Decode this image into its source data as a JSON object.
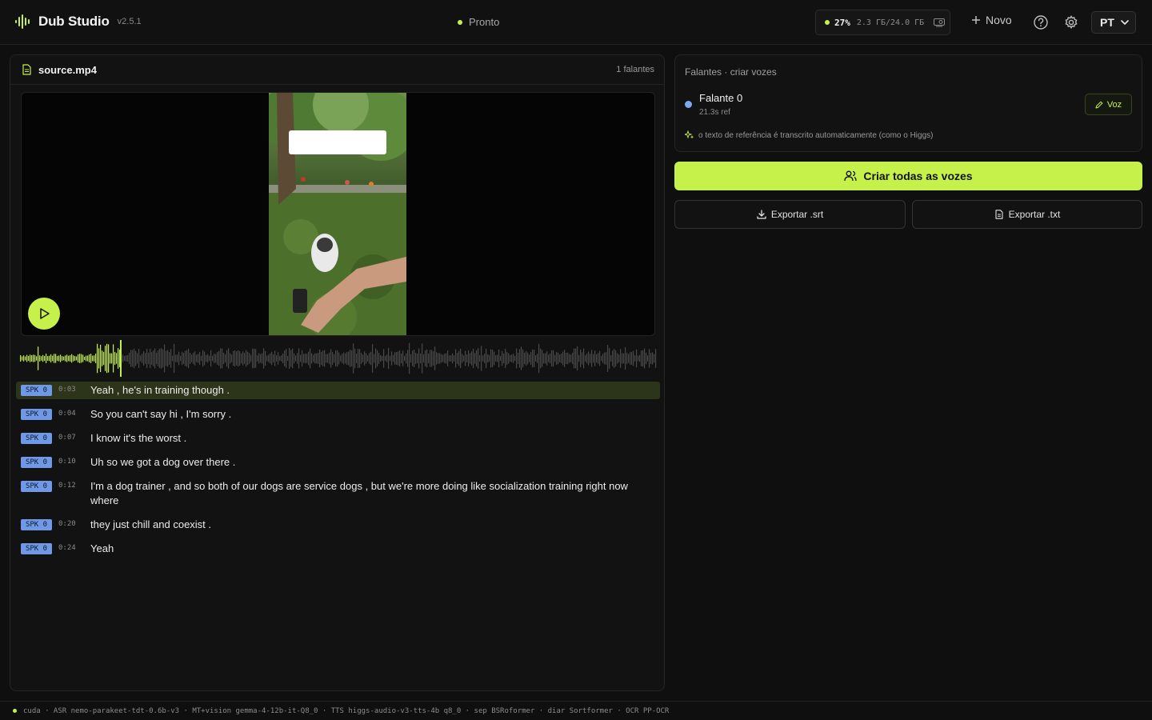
{
  "app": {
    "name": "Dub Studio",
    "version": "v2.5.1",
    "status": "Pronto"
  },
  "gpu": {
    "percent": "27%",
    "memory": "2.3 ГБ/24.0 ГБ"
  },
  "toolbar": {
    "new_label": "Novo",
    "language": "PT"
  },
  "file": {
    "name": "source.mp4",
    "speaker_count": "1 falantes"
  },
  "playback": {
    "progress": 0.157
  },
  "segments": [
    {
      "speaker": "SPK 0",
      "time": "0:03",
      "text": "Yeah , he's in training though .",
      "active": true
    },
    {
      "speaker": "SPK 0",
      "time": "0:04",
      "text": "So you can't say hi , I'm sorry .",
      "active": false
    },
    {
      "speaker": "SPK 0",
      "time": "0:07",
      "text": "I know it's the worst .",
      "active": false
    },
    {
      "speaker": "SPK 0",
      "time": "0:10",
      "text": "Uh so we got a dog over there .",
      "active": false
    },
    {
      "speaker": "SPK 0",
      "time": "0:12",
      "text": "I'm a dog trainer , and so both of our dogs are service dogs , but we're more doing like socialization training right now where",
      "active": false
    },
    {
      "speaker": "SPK 0",
      "time": "0:20",
      "text": "they just chill and coexist .",
      "active": false
    },
    {
      "speaker": "SPK 0",
      "time": "0:24",
      "text": "Yeah",
      "active": false
    }
  ],
  "speakers_panel": {
    "title": "Falantes · criar vozes",
    "speakers": [
      {
        "name": "Falante 0",
        "ref": "21.3s ref",
        "color": "#7ea8f0",
        "voice_button": "Voz"
      }
    ],
    "note": "o texto de referência é transcrito automaticamente (como o Higgs)"
  },
  "actions": {
    "create_all": "Criar todas as vozes",
    "export_srt": "Exportar .srt",
    "export_txt": "Exportar .txt"
  },
  "footer": {
    "text": "cuda · ASR nemo-parakeet-tdt-0.6b-v3 · MT+vision gemma-4-12b-it-Q8_0 · TTS higgs-audio-v3-tts-4b q8_0 · sep BSRoformer · diar Sortformer · OCR PP-OCR"
  },
  "colors": {
    "accent": "#c6f04a",
    "speaker": "#6f98e6",
    "background": "#0f0f0f"
  },
  "icons": [
    "logo-waveform-icon",
    "gpu-card-icon",
    "plus-icon",
    "help-icon",
    "gear-icon",
    "chevron-down-icon",
    "file-text-icon",
    "play-icon",
    "pencil-icon",
    "sparkle-icon",
    "users-icon",
    "download-icon"
  ]
}
